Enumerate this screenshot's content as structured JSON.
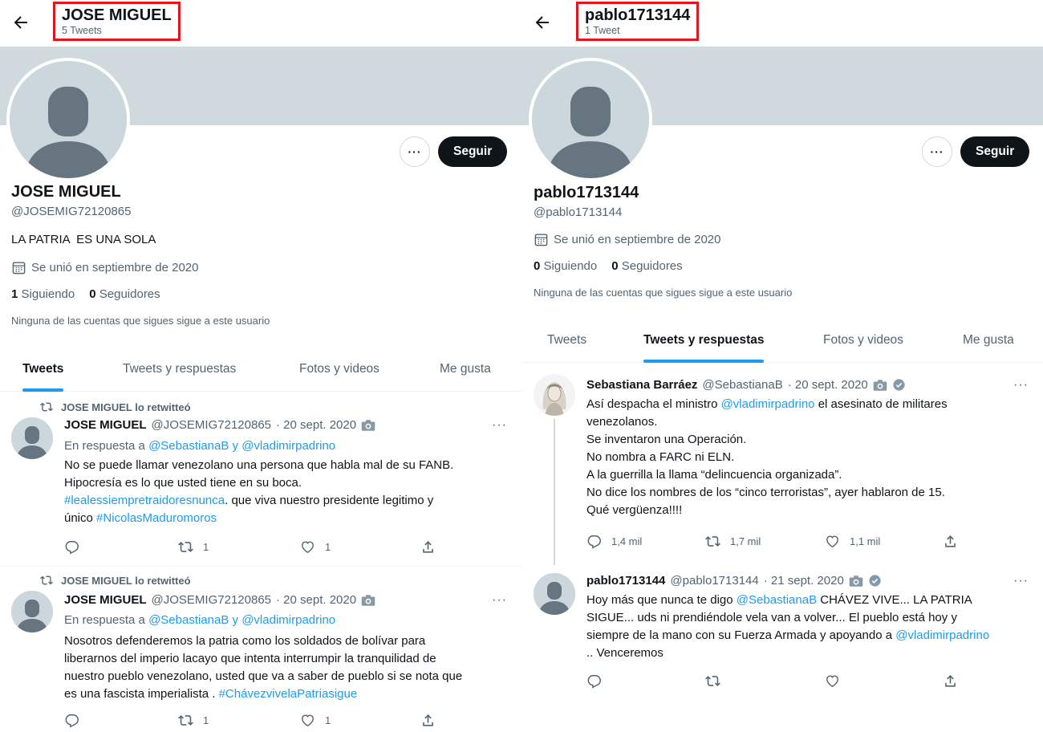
{
  "left": {
    "header": {
      "name": "JOSE MIGUEL",
      "count": "5 Tweets"
    },
    "profile": {
      "name": "JOSE MIGUEL",
      "handle": "@JOSEMIG72120865",
      "bio": "LA PATRIA  ES UNA SOLA",
      "joined": "Se unió en septiembre de 2020",
      "following_count": "1",
      "following_label": "Siguiendo",
      "followers_count": "0",
      "followers_label": "Seguidores",
      "no_followers_note": "Ninguna de las cuentas que sigues sigue a este usuario",
      "follow_label": "Seguir",
      "more_label": "···"
    },
    "tabs": [
      "Tweets",
      "Tweets y respuestas",
      "Fotos y videos",
      "Me gusta"
    ],
    "active_tab": 0,
    "tweets": [
      {
        "retweet_note": "JOSE MIGUEL lo retwitteó",
        "author": "JOSE MIGUEL",
        "handle": "@JOSEMIG72120865",
        "date": "· 20 sept. 2020",
        "reply_prefix": "En respuesta a",
        "reply_to": "@SebastianaB y @vladimirpadrino",
        "lines": [
          {
            "a": "No se puede llamar venezolano una persona que habla mal de su  FANB.",
            "b": "",
            "c": ""
          },
          {
            "a": "Hipocresía  es lo que usted tiene en su boca.",
            "b": "",
            "c": ""
          },
          {
            "a": "",
            "b": "#lealessiempretraidoresnunca",
            "c": ". que viva nuestro  presidente legitimo y"
          },
          {
            "a": "único  ",
            "b": "#NicolasMaduromoros",
            "c": ""
          }
        ],
        "retweets": "1",
        "likes": "1"
      },
      {
        "retweet_note": "JOSE MIGUEL lo retwitteó",
        "author": "JOSE MIGUEL",
        "handle": "@JOSEMIG72120865",
        "date": "· 20 sept. 2020",
        "reply_prefix": "En respuesta a",
        "reply_to": "@SebastianaB y @vladimirpadrino",
        "lines": [
          {
            "a": "Nosotros defenderemos la patria como los soldados  de bolívar para",
            "b": "",
            "c": ""
          },
          {
            "a": "liberarnos del imperio lacayo que intenta interrumpir la tranquilidad de",
            "b": "",
            "c": ""
          },
          {
            "a": "nuestro pueblo venezolano, usted que va a saber de pueblo si se nota que",
            "b": "",
            "c": ""
          },
          {
            "a": "es una fascista imperialista . ",
            "b": "#ChávezvivelaPatriasigue",
            "c": ""
          }
        ],
        "retweets": "1",
        "likes": "1"
      }
    ]
  },
  "right": {
    "header": {
      "name": "pablo1713144",
      "count": "1 Tweet"
    },
    "profile": {
      "name": "pablo1713144",
      "handle": "@pablo1713144",
      "joined": "Se unió en septiembre de 2020",
      "following_count": "0",
      "following_label": "Siguiendo",
      "followers_count": "0",
      "followers_label": "Seguidores",
      "no_followers_note": "Ninguna de las cuentas que sigues sigue a este usuario",
      "follow_label": "Seguir",
      "more_label": "···"
    },
    "tabs": [
      "Tweets",
      "Tweets y respuestas",
      "Fotos y videos",
      "Me gusta"
    ],
    "active_tab": 1,
    "tweets": [
      {
        "author": "Sebastiana Barráez",
        "handle": "@SebastianaB",
        "date": "· 20 sept. 2020",
        "lines": [
          {
            "a": "Así despacha el ministro ",
            "b": "@vladimirpadrino",
            "c": " el asesinato de militares"
          },
          {
            "a": "venezolanos.",
            "b": "",
            "c": ""
          },
          {
            "a": "Se inventaron una Operación.",
            "b": "",
            "c": ""
          },
          {
            "a": "No nombra a FARC ni ELN.",
            "b": "",
            "c": ""
          },
          {
            "a": "A la guerrilla la llama “delincuencia organizada”.",
            "b": "",
            "c": ""
          },
          {
            "a": "No dice los nombres de los “cinco terroristas”, ayer hablaron de 15.",
            "b": "",
            "c": ""
          },
          {
            "a": "Qué vergüenza!!!!",
            "b": "",
            "c": ""
          }
        ],
        "replies": "1,4 mil",
        "retweets": "1,7 mil",
        "likes": "1,1 mil"
      },
      {
        "author": "pablo1713144",
        "handle": "@pablo1713144",
        "date": "· 21 sept. 2020",
        "lines": [
          {
            "a": "Hoy más que nunca te digo ",
            "b": "@SebastianaB",
            "c": " CHÁVEZ VIVE... LA PATRIA"
          },
          {
            "a": "SIGUE... uds ni prendiéndole vela van a volver... El pueblo está hoy y",
            "b": "",
            "c": ""
          },
          {
            "a": "siempre de la mano con su Fuerza Armada y apoyando a ",
            "b": "@vladimirpadrino",
            "c": ""
          },
          {
            "a": ".. Venceremos",
            "b": "",
            "c": ""
          }
        ],
        "replies": "",
        "retweets": "",
        "likes": ""
      }
    ]
  },
  "colors": {
    "accent": "#1d9bf0",
    "highlight_box": "#e3151b",
    "banner": "#cfd9de",
    "button": "#0f1419"
  },
  "icons": [
    "back-arrow-icon",
    "calendar-icon",
    "retweet-icon",
    "camera-icon",
    "verified-icon",
    "reply-icon",
    "like-icon",
    "share-icon",
    "more-icon"
  ]
}
